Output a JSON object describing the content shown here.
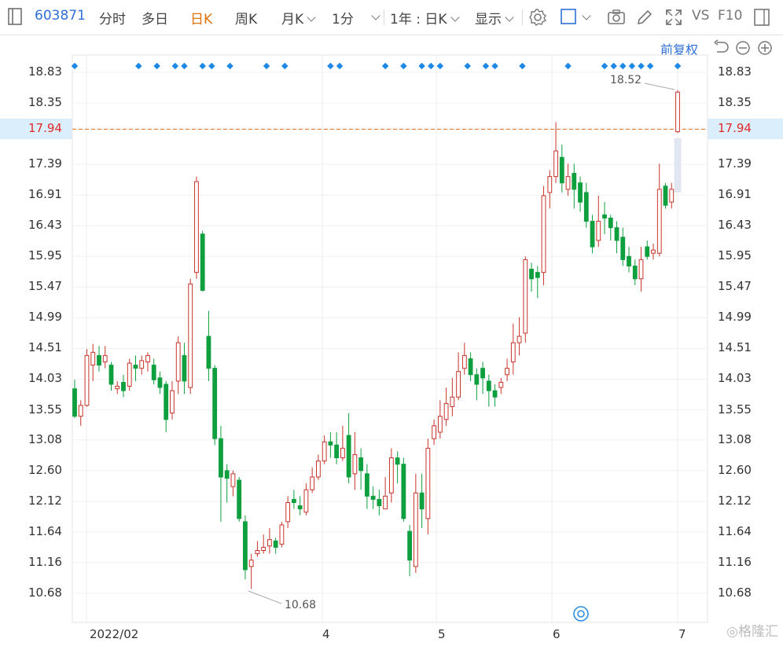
{
  "toolbar": {
    "code": "603871",
    "items": [
      "分时",
      "多日",
      "日K",
      "周K",
      "月K",
      "1分",
      "1年 : 日K",
      "显示"
    ],
    "active": "日K",
    "vs_label": "VS",
    "f10_label": "F10"
  },
  "adjust_label": "前复权",
  "colors": {
    "up": "#c8342b",
    "down": "#0e9f3e",
    "marker": "#1e88e5",
    "current": "#e06d1b"
  },
  "current_price": "17.94",
  "chart_data": {
    "type": "candlestick",
    "y_ticks": [
      "18.83",
      "18.35",
      "17.94",
      "17.39",
      "16.91",
      "16.43",
      "15.95",
      "15.47",
      "14.99",
      "14.51",
      "14.03",
      "13.55",
      "13.08",
      "12.60",
      "12.12",
      "11.64",
      "11.16",
      "10.68"
    ],
    "y_values": [
      18.83,
      18.35,
      17.94,
      17.39,
      16.91,
      16.43,
      15.95,
      15.47,
      14.99,
      14.51,
      14.03,
      13.55,
      13.08,
      12.6,
      12.12,
      11.64,
      11.16,
      10.68
    ],
    "x_ticks": [
      "2022/02",
      "4",
      "5",
      "6",
      "7"
    ],
    "high_label": "18.52",
    "low_label": "10.68",
    "ylim": [
      10.68,
      18.83
    ],
    "candles": [
      [
        13.88,
        13.45,
        14.02,
        13.42
      ],
      [
        13.45,
        13.62,
        13.7,
        13.3
      ],
      [
        13.62,
        14.4,
        14.5,
        13.6
      ],
      [
        14.25,
        14.45,
        14.58,
        14.0
      ],
      [
        14.4,
        14.25,
        14.55,
        14.15
      ],
      [
        14.3,
        14.4,
        14.55,
        14.2
      ],
      [
        14.25,
        13.95,
        14.3,
        13.85
      ],
      [
        13.88,
        13.92,
        14.0,
        13.8
      ],
      [
        13.98,
        13.85,
        14.1,
        13.75
      ],
      [
        13.92,
        14.28,
        14.35,
        13.85
      ],
      [
        14.25,
        14.2,
        14.4,
        14.0
      ],
      [
        14.2,
        14.32,
        14.4,
        14.1
      ],
      [
        14.3,
        14.4,
        14.45,
        14.15
      ],
      [
        14.25,
        14.02,
        14.35,
        13.95
      ],
      [
        14.05,
        13.9,
        14.15,
        13.8
      ],
      [
        13.95,
        13.4,
        14.0,
        13.2
      ],
      [
        13.5,
        13.85,
        14.0,
        13.4
      ],
      [
        14.0,
        14.6,
        14.7,
        13.8
      ],
      [
        14.4,
        14.0,
        14.6,
        13.8
      ],
      [
        13.9,
        15.52,
        15.6,
        13.8
      ],
      [
        15.7,
        17.12,
        17.2,
        15.6
      ],
      [
        16.3,
        15.42,
        16.35,
        15.4
      ],
      [
        14.7,
        14.2,
        15.1,
        14.0
      ],
      [
        14.2,
        13.1,
        14.25,
        13.0
      ],
      [
        13.1,
        12.5,
        13.3,
        11.8
      ],
      [
        12.6,
        12.48,
        12.7,
        12.1
      ],
      [
        12.35,
        12.55,
        12.6,
        12.2
      ],
      [
        12.45,
        11.85,
        12.5,
        11.8
      ],
      [
        11.8,
        11.05,
        11.9,
        10.9
      ],
      [
        11.1,
        11.2,
        11.3,
        10.75
      ],
      [
        11.3,
        11.35,
        11.5,
        11.25
      ],
      [
        11.35,
        11.4,
        11.6,
        11.3
      ],
      [
        11.42,
        11.52,
        11.7,
        11.3
      ],
      [
        11.5,
        11.4,
        11.55,
        11.3
      ],
      [
        11.45,
        11.75,
        11.8,
        11.4
      ],
      [
        11.8,
        12.1,
        12.2,
        11.7
      ],
      [
        12.15,
        12.1,
        12.3,
        12.0
      ],
      [
        12.05,
        12.0,
        12.2,
        11.9
      ],
      [
        11.95,
        12.3,
        12.4,
        11.9
      ],
      [
        12.3,
        12.5,
        12.65,
        12.25
      ],
      [
        12.5,
        12.75,
        12.85,
        12.45
      ],
      [
        12.75,
        13.05,
        13.15,
        12.7
      ],
      [
        13.05,
        13.0,
        13.2,
        12.8
      ],
      [
        13.0,
        12.8,
        13.2,
        12.7
      ],
      [
        12.8,
        12.95,
        13.3,
        12.75
      ],
      [
        13.15,
        12.5,
        13.5,
        12.4
      ],
      [
        12.55,
        12.85,
        13.2,
        12.3
      ],
      [
        12.8,
        12.6,
        12.95,
        12.3
      ],
      [
        12.55,
        12.2,
        12.7,
        12.0
      ],
      [
        12.2,
        12.15,
        12.35,
        12.0
      ],
      [
        12.15,
        12.05,
        12.3,
        11.9
      ],
      [
        12.0,
        12.2,
        12.5,
        12.0
      ],
      [
        12.25,
        12.8,
        12.95,
        12.1
      ],
      [
        12.8,
        12.7,
        12.9,
        12.4
      ],
      [
        12.7,
        11.85,
        12.8,
        11.8
      ],
      [
        11.65,
        11.2,
        11.75,
        10.95
      ],
      [
        11.1,
        12.25,
        12.55,
        11.0
      ],
      [
        12.25,
        12.0,
        12.55,
        11.7
      ],
      [
        11.85,
        12.95,
        13.1,
        11.6
      ],
      [
        13.1,
        13.3,
        13.4,
        13.0
      ],
      [
        13.2,
        13.45,
        13.7,
        13.1
      ],
      [
        13.4,
        13.65,
        13.9,
        13.3
      ],
      [
        13.6,
        13.75,
        14.05,
        13.45
      ],
      [
        13.75,
        14.15,
        14.45,
        13.7
      ],
      [
        14.2,
        14.4,
        14.6,
        14.1
      ],
      [
        14.35,
        14.1,
        14.45,
        14.0
      ],
      [
        14.1,
        13.95,
        14.2,
        13.7
      ],
      [
        14.2,
        14.05,
        14.3,
        13.8
      ],
      [
        14.0,
        13.85,
        14.1,
        13.6
      ],
      [
        13.85,
        13.75,
        13.95,
        13.6
      ],
      [
        13.9,
        13.98,
        14.05,
        13.8
      ],
      [
        14.1,
        14.2,
        14.35,
        14.0
      ],
      [
        14.3,
        14.6,
        14.9,
        14.1
      ],
      [
        14.6,
        14.7,
        15.0,
        14.4
      ],
      [
        14.75,
        15.9,
        15.95,
        14.6
      ],
      [
        15.75,
        15.6,
        15.85,
        15.4
      ],
      [
        15.7,
        15.62,
        15.8,
        15.3
      ],
      [
        15.7,
        16.9,
        17.05,
        15.5
      ],
      [
        16.95,
        17.2,
        17.3,
        16.7
      ],
      [
        17.2,
        17.6,
        18.05,
        17.1
      ],
      [
        17.5,
        17.1,
        17.7,
        16.95
      ],
      [
        17.0,
        17.2,
        17.4,
        16.9
      ],
      [
        17.25,
        17.0,
        17.4,
        16.7
      ],
      [
        17.1,
        16.8,
        17.2,
        16.65
      ],
      [
        16.95,
        16.5,
        17.1,
        16.4
      ],
      [
        16.5,
        16.1,
        16.6,
        16.0
      ],
      [
        16.2,
        16.5,
        16.9,
        16.1
      ],
      [
        16.6,
        16.55,
        16.8,
        16.3
      ],
      [
        16.55,
        16.4,
        16.6,
        16.2
      ],
      [
        16.4,
        16.2,
        16.5,
        16.0
      ],
      [
        16.25,
        15.9,
        16.4,
        15.8
      ],
      [
        15.95,
        15.8,
        16.1,
        15.7
      ],
      [
        15.8,
        15.6,
        15.9,
        15.5
      ],
      [
        15.6,
        15.9,
        16.1,
        15.4
      ],
      [
        16.1,
        15.95,
        16.2,
        15.9
      ],
      [
        16.0,
        16.05,
        16.15,
        15.9
      ],
      [
        16.0,
        17.0,
        17.4,
        15.95
      ],
      [
        17.05,
        16.75,
        17.1,
        16.7
      ],
      [
        16.8,
        17.0,
        17.1,
        16.7
      ],
      [
        17.9,
        18.52,
        18.55,
        17.88
      ]
    ],
    "markers_x": [
      0,
      7,
      9,
      11,
      12,
      14,
      15,
      17,
      21,
      23,
      28,
      29,
      34,
      36,
      38,
      39,
      40,
      43,
      45,
      46,
      49,
      54,
      58,
      59,
      60,
      61,
      62,
      63,
      66
    ]
  }
}
